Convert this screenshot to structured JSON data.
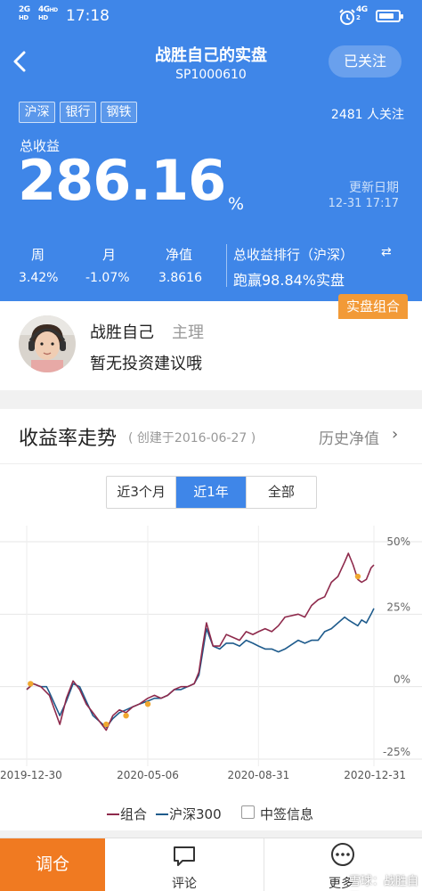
{
  "status_bar": {
    "net1_top": "2G",
    "net1_bottom": "HD",
    "net2_top": "4G",
    "net2_sup": "HD",
    "net2_bottom": "HD",
    "time": "17:18",
    "net3_top": "4G",
    "net3_bottom": "2",
    "battery_level": 0.8
  },
  "header": {
    "title": "战胜自己的实盘",
    "subtitle": "SP1000610",
    "follow_label": "已关注"
  },
  "tags": [
    "沪深",
    "银行",
    "钢铁"
  ],
  "followers": "2481 人关注",
  "total": {
    "label": "总收益",
    "value": "286.16",
    "unit": "%",
    "update_label": "更新日期",
    "update_time": "12-31 17:17"
  },
  "stats": [
    {
      "label": "周",
      "value": "3.42%"
    },
    {
      "label": "月",
      "value": "-1.07%"
    },
    {
      "label": "净值",
      "value": "3.8616"
    }
  ],
  "rank": {
    "label": "总收益排行（沪深）",
    "swap_icon": "⇄",
    "value": "跑赢98.84%实盘"
  },
  "real_badge": "实盘组合",
  "owner": {
    "name": "战胜自己",
    "role": "主理",
    "advice": "暂无投资建议哦"
  },
  "chart_section": {
    "title": "收益率走势",
    "created": "( 创建于2016-06-27 )",
    "history_link": "历史净值",
    "chevron": "›"
  },
  "ranges": [
    {
      "label": "近3个月",
      "active": false
    },
    {
      "label": "近1年",
      "active": true
    },
    {
      "label": "全部",
      "active": false
    }
  ],
  "chart_data": {
    "type": "line",
    "x_ticks": [
      "2019-12-30",
      "2020-05-06",
      "2020-08-31",
      "2020-12-31"
    ],
    "y_ticks": [
      "50%",
      "25%",
      "0%",
      "-25%"
    ],
    "ylim": [
      -25,
      50
    ],
    "xlim": [
      "2019-12-30",
      "2020-12-31"
    ],
    "grid": true,
    "legend_position": "bottom",
    "series": [
      {
        "name": "组合",
        "color": "#8e2a4c",
        "points": [
          [
            "2019-12-30",
            -1
          ],
          [
            "2020-01-06",
            1
          ],
          [
            "2020-01-14",
            0
          ],
          [
            "2020-01-20",
            -2
          ],
          [
            "2020-01-23",
            -3
          ],
          [
            "2020-02-03",
            -13
          ],
          [
            "2020-02-10",
            -4
          ],
          [
            "2020-02-17",
            2
          ],
          [
            "2020-02-24",
            -1
          ],
          [
            "2020-03-02",
            -6
          ],
          [
            "2020-03-09",
            -9
          ],
          [
            "2020-03-16",
            -12
          ],
          [
            "2020-03-23",
            -15
          ],
          [
            "2020-03-30",
            -10
          ],
          [
            "2020-04-06",
            -8
          ],
          [
            "2020-04-13",
            -9
          ],
          [
            "2020-04-20",
            -7
          ],
          [
            "2020-04-27",
            -6
          ],
          [
            "2020-05-06",
            -4
          ],
          [
            "2020-05-13",
            -3
          ],
          [
            "2020-05-20",
            -4
          ],
          [
            "2020-05-27",
            -3
          ],
          [
            "2020-06-03",
            -1
          ],
          [
            "2020-06-10",
            0
          ],
          [
            "2020-06-17",
            0
          ],
          [
            "2020-06-24",
            1
          ],
          [
            "2020-06-29",
            5
          ],
          [
            "2020-07-03",
            14
          ],
          [
            "2020-07-07",
            22
          ],
          [
            "2020-07-14",
            14
          ],
          [
            "2020-07-21",
            14
          ],
          [
            "2020-07-28",
            18
          ],
          [
            "2020-08-04",
            17
          ],
          [
            "2020-08-11",
            16
          ],
          [
            "2020-08-18",
            19
          ],
          [
            "2020-08-25",
            18
          ],
          [
            "2020-08-31",
            19
          ],
          [
            "2020-09-07",
            20
          ],
          [
            "2020-09-14",
            19
          ],
          [
            "2020-09-21",
            21
          ],
          [
            "2020-09-28",
            24
          ],
          [
            "2020-10-12",
            25
          ],
          [
            "2020-10-19",
            24
          ],
          [
            "2020-10-26",
            28
          ],
          [
            "2020-11-02",
            30
          ],
          [
            "2020-11-09",
            31
          ],
          [
            "2020-11-16",
            36
          ],
          [
            "2020-11-23",
            38
          ],
          [
            "2020-11-30",
            43
          ],
          [
            "2020-12-04",
            46
          ],
          [
            "2020-12-09",
            42
          ],
          [
            "2020-12-14",
            37
          ],
          [
            "2020-12-18",
            36
          ],
          [
            "2020-12-23",
            37
          ],
          [
            "2020-12-28",
            41
          ],
          [
            "2020-12-31",
            42
          ]
        ]
      },
      {
        "name": "沪深300",
        "color": "#1e5b8c",
        "points": [
          [
            "2019-12-30",
            -1
          ],
          [
            "2020-01-06",
            1
          ],
          [
            "2020-01-14",
            0
          ],
          [
            "2020-01-20",
            0
          ],
          [
            "2020-01-23",
            -2
          ],
          [
            "2020-02-03",
            -10
          ],
          [
            "2020-02-10",
            -5
          ],
          [
            "2020-02-17",
            1
          ],
          [
            "2020-02-24",
            0
          ],
          [
            "2020-03-02",
            -5
          ],
          [
            "2020-03-09",
            -10
          ],
          [
            "2020-03-16",
            -12
          ],
          [
            "2020-03-23",
            -14
          ],
          [
            "2020-03-30",
            -11
          ],
          [
            "2020-04-06",
            -9
          ],
          [
            "2020-04-13",
            -8
          ],
          [
            "2020-04-20",
            -7
          ],
          [
            "2020-04-27",
            -6
          ],
          [
            "2020-05-06",
            -5
          ],
          [
            "2020-05-13",
            -4
          ],
          [
            "2020-05-20",
            -4
          ],
          [
            "2020-05-27",
            -3
          ],
          [
            "2020-06-03",
            -1
          ],
          [
            "2020-06-10",
            -1
          ],
          [
            "2020-06-17",
            0
          ],
          [
            "2020-06-24",
            1
          ],
          [
            "2020-06-29",
            4
          ],
          [
            "2020-07-03",
            12
          ],
          [
            "2020-07-07",
            20
          ],
          [
            "2020-07-14",
            14
          ],
          [
            "2020-07-21",
            13
          ],
          [
            "2020-07-28",
            15
          ],
          [
            "2020-08-04",
            15
          ],
          [
            "2020-08-11",
            14
          ],
          [
            "2020-08-18",
            16
          ],
          [
            "2020-08-25",
            15
          ],
          [
            "2020-08-31",
            14
          ],
          [
            "2020-09-07",
            13
          ],
          [
            "2020-09-14",
            13
          ],
          [
            "2020-09-21",
            12
          ],
          [
            "2020-09-28",
            13
          ],
          [
            "2020-10-12",
            16
          ],
          [
            "2020-10-19",
            15
          ],
          [
            "2020-10-26",
            16
          ],
          [
            "2020-11-02",
            16
          ],
          [
            "2020-11-09",
            19
          ],
          [
            "2020-11-16",
            20
          ],
          [
            "2020-11-23",
            22
          ],
          [
            "2020-11-30",
            24
          ],
          [
            "2020-12-04",
            23
          ],
          [
            "2020-12-09",
            22
          ],
          [
            "2020-12-14",
            21
          ],
          [
            "2020-12-18",
            23
          ],
          [
            "2020-12-23",
            22
          ],
          [
            "2020-12-28",
            25
          ],
          [
            "2020-12-31",
            27
          ]
        ]
      }
    ],
    "trade_markers": [
      [
        "2020-01-03",
        1
      ],
      [
        "2020-03-23",
        -13
      ],
      [
        "2020-04-13",
        -10
      ],
      [
        "2020-05-06",
        -6
      ],
      [
        "2020-12-14",
        38
      ]
    ],
    "marker_color": "#f0a830"
  },
  "legend": [
    {
      "label": "组合",
      "color": "#8e2a4c"
    },
    {
      "label": "沪深300",
      "color": "#1e5b8c"
    },
    {
      "label": "中签信息"
    }
  ],
  "bottom_bar": {
    "trade": "调仓",
    "comment": "评论",
    "more": "更多",
    "watermark": "雪球：战胜自己"
  }
}
